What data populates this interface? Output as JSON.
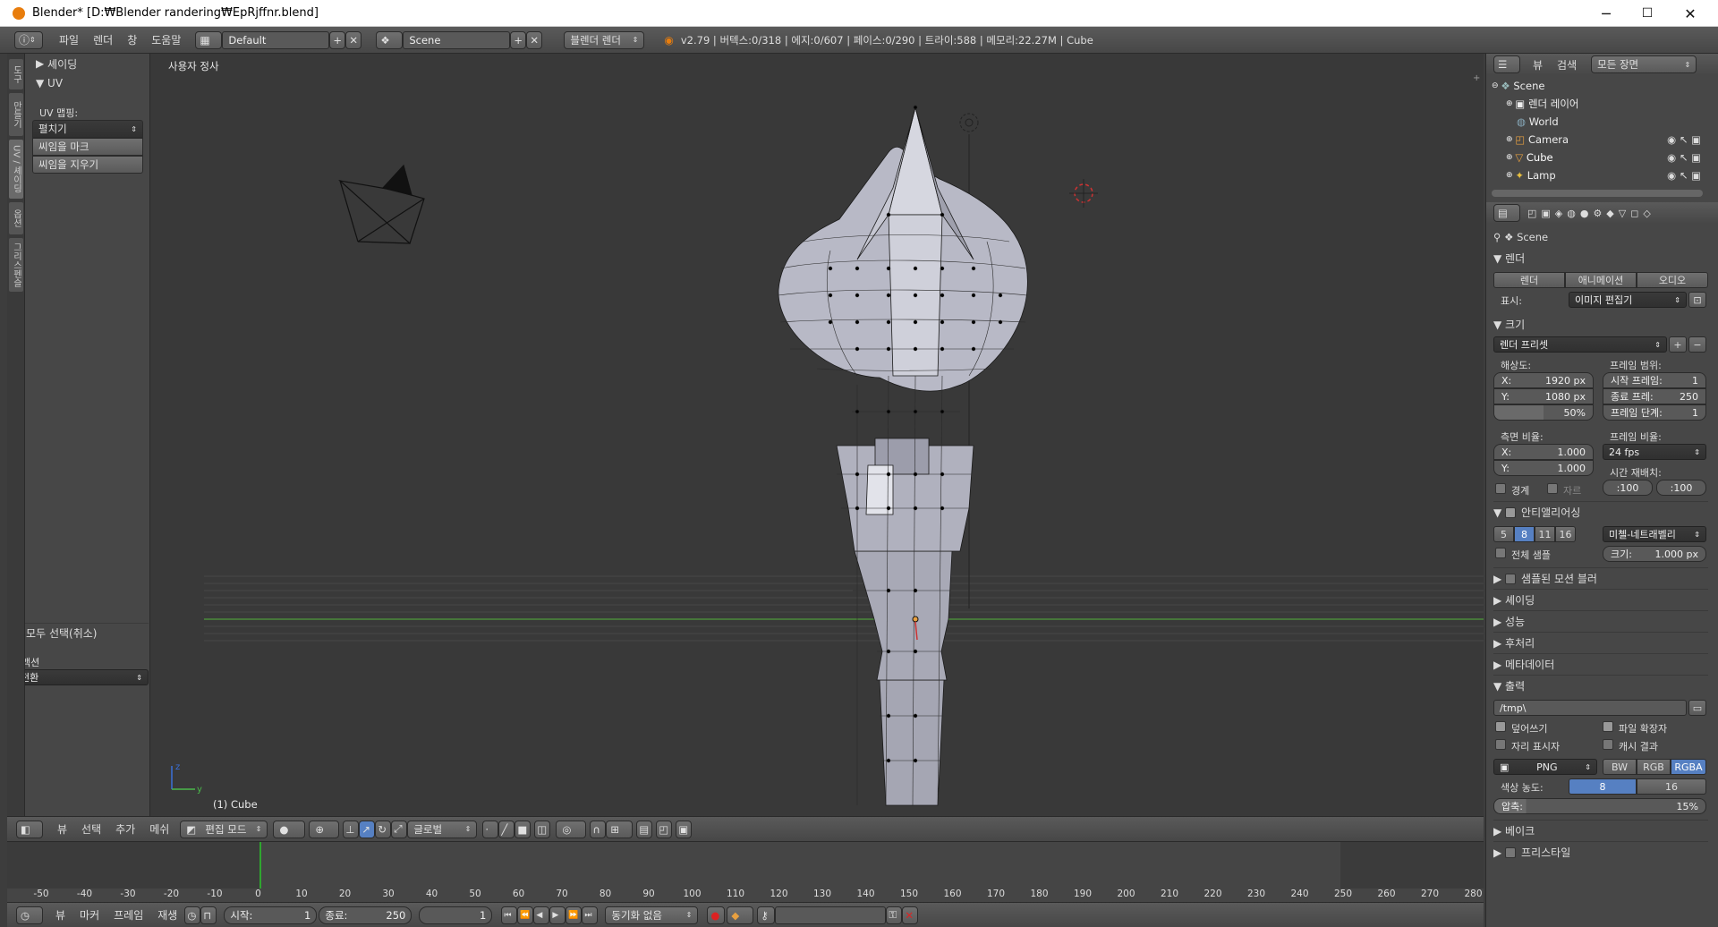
{
  "window": {
    "title": "Blender* [D:₩Blender randering₩EpRjffnr.blend]",
    "minimize": "─",
    "maximize": "☐",
    "close": "✕"
  },
  "topbar": {
    "menus": [
      "파일",
      "렌더",
      "창",
      "도움말"
    ],
    "layout": "Default",
    "scene": "Scene",
    "engine": "블렌더 렌더",
    "stats": "v2.79 | 버텍스:0/318 | 에지:0/607 | 페이스:0/290 | 트라이:588 | 메모리:22.27M | Cube"
  },
  "toolshelf": {
    "tabs": [
      "도구",
      "만들기",
      "UV / 셰이딩",
      "옵션",
      "그리스펜슬"
    ],
    "shading_panel": "셰이딩",
    "uv_panel": "UV",
    "uv_mapping_label": "UV 맵핑:",
    "unwrap": "펼치기",
    "mark_seam": "씨임을 마크",
    "clear_seam": "씨임을 지우기",
    "operator_panel": "모두 선택(취소)",
    "action_label": "액션",
    "action_value": "전환"
  },
  "viewport": {
    "label": "사용자 정사",
    "object_info": "(1) Cube"
  },
  "vp_header": {
    "menus": [
      "뷰",
      "선택",
      "추가",
      "메쉬"
    ],
    "mode": "편집 모드",
    "orientation": "글로벌"
  },
  "timeline": {
    "ticks": [
      "-50",
      "-40",
      "-30",
      "-20",
      "-10",
      "0",
      "10",
      "20",
      "30",
      "40",
      "50",
      "60",
      "70",
      "80",
      "90",
      "100",
      "110",
      "120",
      "130",
      "140",
      "150",
      "160",
      "170",
      "180",
      "190",
      "200",
      "210",
      "220",
      "230",
      "240",
      "250",
      "260",
      "270",
      "280"
    ],
    "menus": [
      "뷰",
      "마커",
      "프레임",
      "재생"
    ],
    "start": "시작:",
    "start_val": "1",
    "end": "종료:",
    "end_val": "250",
    "current": "1",
    "sync": "동기화 없음"
  },
  "outliner": {
    "menus": [
      "뷰",
      "검색"
    ],
    "filter": "모든 장면",
    "items": [
      {
        "name": "Scene"
      },
      {
        "name": "렌더 레이어"
      },
      {
        "name": "World"
      },
      {
        "name": "Camera"
      },
      {
        "name": "Cube"
      },
      {
        "name": "Lamp"
      }
    ]
  },
  "props": {
    "context": "Scene",
    "render_panel": "렌더",
    "render_btn": "렌더",
    "anim_btn": "애니메이션",
    "audio_btn": "오디오",
    "display_label": "표시:",
    "display_value": "이미지 편집기",
    "dimensions_panel": "크기",
    "preset": "렌더 프리셋",
    "resolution": "해상도:",
    "res_x": "X:",
    "res_x_val": "1920 px",
    "res_y": "Y:",
    "res_y_val": "1080 px",
    "res_pct": "50%",
    "frame_range": "프레임 범위:",
    "start_frame": "시작 프레임:",
    "start_frame_val": "1",
    "end_frame": "종료 프레:",
    "end_frame_val": "250",
    "frame_step": "프레임 단계:",
    "frame_step_val": "1",
    "aspect": "측면 비율:",
    "asp_x": "X:",
    "asp_x_val": "1.000",
    "asp_y": "Y:",
    "asp_y_val": "1.000",
    "frame_rate": "프레임 비율:",
    "fps": "24 fps",
    "time_remap": "시간 재배치:",
    "remap_old": ":100",
    "remap_new": ":100",
    "border": "경계",
    "crop": "자르",
    "aa_panel": "안티앨리어싱",
    "aa_samples": [
      "5",
      "8",
      "11",
      "16"
    ],
    "aa_filter": "미첼-네트래벨리",
    "full_sample": "전체 샘플",
    "aa_size": "크기:",
    "aa_size_val": "1.000 px",
    "motion_blur": "샘플된 모션 블러",
    "shading": "셰이딩",
    "performance": "성능",
    "postprocess": "후처리",
    "metadata": "메타데이터",
    "output_panel": "출력",
    "output_path": "/tmp\\",
    "overwrite": "덮어쓰기",
    "file_ext": "파일 확장자",
    "placeholders": "자리 표시자",
    "cache_result": "캐시 결과",
    "format": "PNG",
    "color_modes": [
      "BW",
      "RGB",
      "RGBA"
    ],
    "color_depth": "색상 농도:",
    "depth_8": "8",
    "depth_16": "16",
    "compression": "압축:",
    "compression_val": "15%",
    "bake": "베이크",
    "freestyle": "프리스타일"
  },
  "colors": {
    "accent": "#5680c2",
    "grid_x": "#8f3a3a",
    "grid_y": "#4b8a3a",
    "timeline_cursor": "#2fa52f"
  }
}
